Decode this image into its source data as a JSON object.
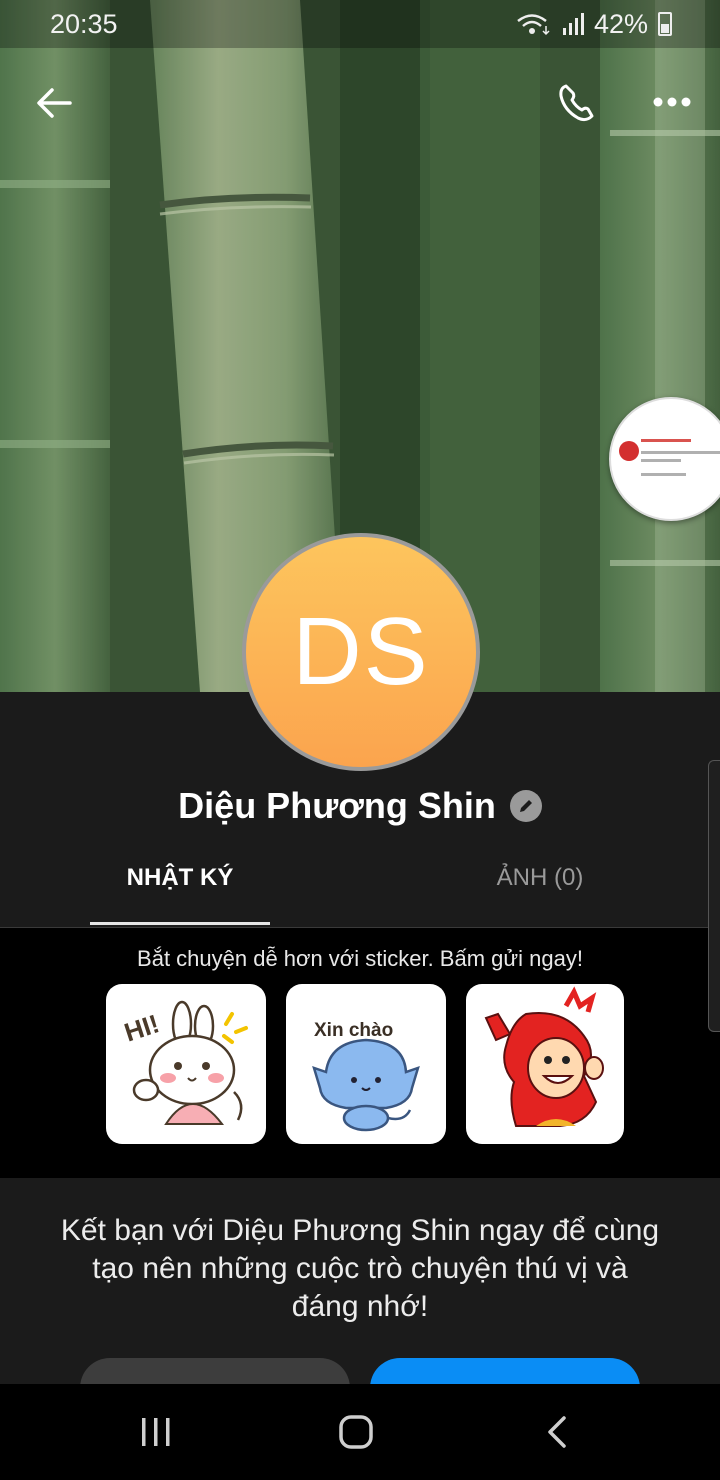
{
  "status_bar": {
    "time": "20:35",
    "battery": "42%"
  },
  "profile": {
    "avatar_initials": "DS",
    "name": "Diệu Phương Shin",
    "avatar_colors": [
      "#fdc55d",
      "#fba44e"
    ]
  },
  "tabs": [
    {
      "label": "NHẬT KÝ",
      "selected": true
    },
    {
      "label": "ẢNH (0)",
      "selected": false
    }
  ],
  "stickers": {
    "hint": "Bắt chuyện dễ hơn với sticker. Bấm gửi ngay!",
    "items": [
      {
        "label": "HI!",
        "icon": "bunny-hi-icon"
      },
      {
        "label": "Xin chào",
        "icon": "blue-cat-hello-icon"
      },
      {
        "label": "",
        "icon": "red-monkey-wave-icon"
      }
    ]
  },
  "friend_prompt": {
    "text": "Kết bạn với Diệu Phương Shin ngay để cùng tạo nên những cuộc trò chuyện thú vị và đáng nhớ!"
  },
  "colors": {
    "accent": "#0a8df5",
    "background": "#1b1b1b"
  }
}
